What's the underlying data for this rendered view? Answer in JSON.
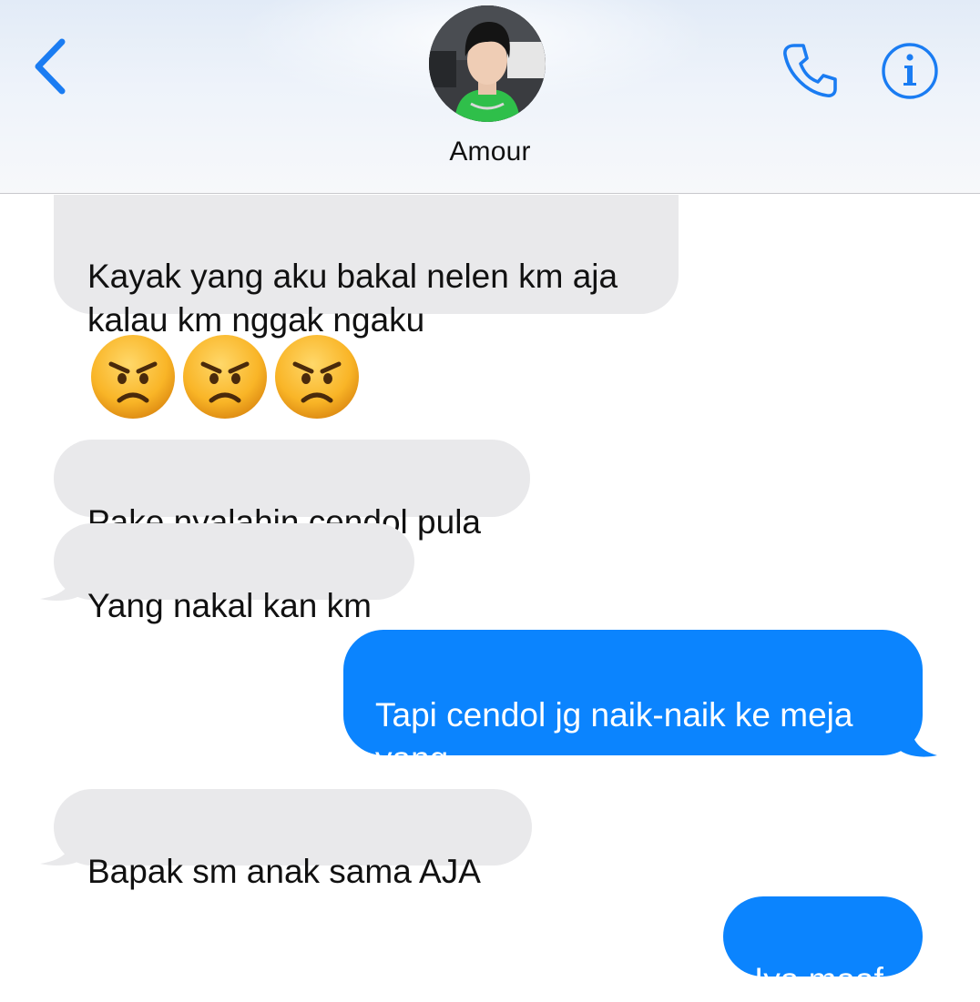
{
  "header": {
    "contact_name": "Amour",
    "back_icon": "chevron-left-icon",
    "call_icon": "phone-icon",
    "info_icon": "info-icon",
    "accent_color": "#1a7cf2"
  },
  "messages": [
    {
      "direction": "incoming",
      "text": "Kayak yang aku bakal nelen km aja\nkalau km nggak ngaku"
    },
    {
      "direction": "incoming",
      "type": "emoji",
      "emojis": [
        "angry-face-emoji",
        "angry-face-emoji",
        "angry-face-emoji"
      ]
    },
    {
      "direction": "incoming",
      "text": "Pake nyalahin cendol pula"
    },
    {
      "direction": "incoming",
      "text": "Yang nakal kan km"
    },
    {
      "direction": "outgoing",
      "text": "Tapi cendol jg naik-naik ke meja\nyang..."
    },
    {
      "direction": "incoming",
      "text": "Bapak sm anak sama AJA"
    },
    {
      "direction": "outgoing",
      "text": "Iya maaf"
    }
  ],
  "colors": {
    "incoming_bubble": "#e9e9eb",
    "outgoing_bubble": "#0b84fe"
  }
}
